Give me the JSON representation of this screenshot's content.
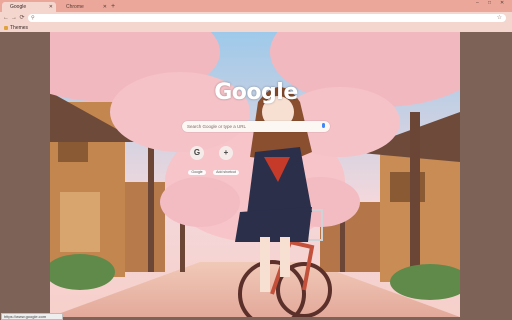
{
  "tabs": [
    {
      "label": "Google",
      "active": true
    },
    {
      "label": "Chrome",
      "active": false
    }
  ],
  "window_controls": {
    "minimize": "–",
    "maximize": "□",
    "close": "✕"
  },
  "toolbar": {
    "back": "←",
    "forward": "→",
    "reload": "⟳",
    "omnibox_value": "",
    "icons": [
      "search-icon",
      "star-icon"
    ]
  },
  "bookmarks": [
    {
      "label": "Themes",
      "icon": "apps-icon"
    }
  ],
  "ntp": {
    "logo_text": "Google",
    "search_placeholder": "Search Google or type a URL",
    "shortcuts": [
      {
        "label": "Google",
        "icon_letter": "G"
      },
      {
        "label": "Add shortcut",
        "icon_letter": "+"
      }
    ]
  },
  "status_bar": {
    "text": "https://www.google.com"
  },
  "colors": {
    "tab_strip": "#eaa79a",
    "toolbar": "#f4d6cf",
    "frame": "#7d6357",
    "blossom": "#f2b8c0"
  }
}
